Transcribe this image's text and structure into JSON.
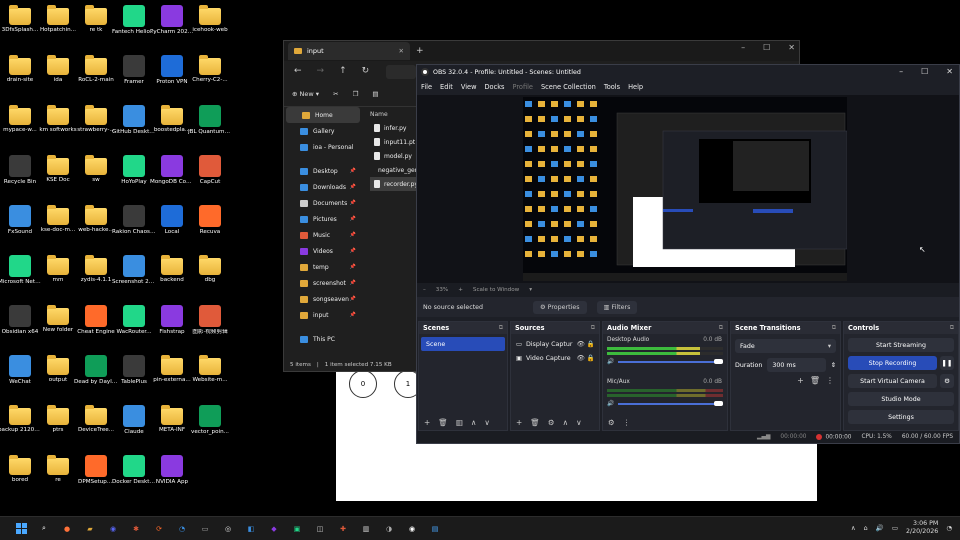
{
  "desktop_icons": [
    {
      "label": "3DfsSplash...",
      "kind": "folder"
    },
    {
      "label": "Hotpatchin...",
      "kind": "folder"
    },
    {
      "label": "re tk",
      "kind": "folder"
    },
    {
      "label": "Fantech Helios XD3",
      "kind": "app"
    },
    {
      "label": "PyCharm 2025.3.2.1",
      "kind": "app"
    },
    {
      "label": "icehook-web",
      "kind": "folder"
    },
    {
      "label": "drain-site",
      "kind": "folder"
    },
    {
      "label": "ida",
      "kind": "folder"
    },
    {
      "label": "RoCL-2-main",
      "kind": "folder"
    },
    {
      "label": "Framer",
      "kind": "app"
    },
    {
      "label": "Proton VPN",
      "kind": "app"
    },
    {
      "label": "Cherry-C2-...",
      "kind": "folder"
    },
    {
      "label": "mypace-w...",
      "kind": "folder"
    },
    {
      "label": "km softworks",
      "kind": "folder"
    },
    {
      "label": "strawberry-...",
      "kind": "folder"
    },
    {
      "label": "GitHub Desktop",
      "kind": "app"
    },
    {
      "label": "boostedpla...",
      "kind": "folder"
    },
    {
      "label": "JBL QuantumE...",
      "kind": "app"
    },
    {
      "label": "Recycle Bin",
      "kind": "app"
    },
    {
      "label": "KSE Doc",
      "kind": "folder"
    },
    {
      "label": "sw",
      "kind": "folder"
    },
    {
      "label": "HoYoPlay",
      "kind": "app"
    },
    {
      "label": "MongoDB Compass",
      "kind": "app"
    },
    {
      "label": "CapCut",
      "kind": "app"
    },
    {
      "label": "FxSound",
      "kind": "app"
    },
    {
      "label": "kse-doc-m...",
      "kind": "folder"
    },
    {
      "label": "web-hacke...",
      "kind": "folder"
    },
    {
      "label": "Rakion Chaos Force",
      "kind": "app"
    },
    {
      "label": "Local",
      "kind": "app"
    },
    {
      "label": "Recuva",
      "kind": "app"
    },
    {
      "label": "Microsoft Network ...",
      "kind": "app"
    },
    {
      "label": "mm",
      "kind": "folder"
    },
    {
      "label": "zydis-4.1.1",
      "kind": "folder"
    },
    {
      "label": "Screenshot 2026-01-...",
      "kind": "app"
    },
    {
      "label": "backend",
      "kind": "folder"
    },
    {
      "label": "dbg",
      "kind": "folder"
    },
    {
      "label": "Obsidian x64",
      "kind": "app"
    },
    {
      "label": "New folder",
      "kind": "folder"
    },
    {
      "label": "Cheat Engine",
      "kind": "app"
    },
    {
      "label": "WacRouter...",
      "kind": "app"
    },
    {
      "label": "Fishstrap",
      "kind": "app"
    },
    {
      "label": "图影·视频剪辑",
      "kind": "app"
    },
    {
      "label": "WeChat",
      "kind": "app"
    },
    {
      "label": "output",
      "kind": "folder"
    },
    {
      "label": "Dead by Daylight",
      "kind": "app"
    },
    {
      "label": "TablePlus",
      "kind": "app"
    },
    {
      "label": "pin-externa...",
      "kind": "folder"
    },
    {
      "label": "Website-m...",
      "kind": "folder"
    },
    {
      "label": "backup 21202...",
      "kind": "folder"
    },
    {
      "label": "ptrs",
      "kind": "folder"
    },
    {
      "label": "DeviceTree...",
      "kind": "folder"
    },
    {
      "label": "Claude",
      "kind": "app"
    },
    {
      "label": "META-INF",
      "kind": "folder"
    },
    {
      "label": "vector_poin...",
      "kind": "app"
    },
    {
      "label": "bored",
      "kind": "folder"
    },
    {
      "label": "re",
      "kind": "folder"
    },
    {
      "label": "DPMSetup....",
      "kind": "app"
    },
    {
      "label": "Docker Desktop",
      "kind": "app"
    },
    {
      "label": "NVIDIA App",
      "kind": "app"
    }
  ],
  "background_window": {
    "nodes": [
      "0",
      "1"
    ]
  },
  "explorer": {
    "tab_title": "input",
    "new_tab": "+",
    "new_button": "New",
    "sidebar": [
      {
        "label": "Home",
        "active": true,
        "color": "#e0a83a"
      },
      {
        "label": "Gallery",
        "active": false,
        "color": "#3a8ee0"
      },
      {
        "label": "ioa - Personal",
        "active": false,
        "color": "#3a8ee0"
      },
      {
        "label": "Desktop",
        "active": false,
        "color": "#3a8ee0"
      },
      {
        "label": "Downloads",
        "active": false,
        "color": "#3a8ee0"
      },
      {
        "label": "Documents",
        "active": false,
        "color": "#cccccc"
      },
      {
        "label": "Pictures",
        "active": false,
        "color": "#3a8ee0"
      },
      {
        "label": "Music",
        "active": false,
        "color": "#e05a3a"
      },
      {
        "label": "Videos",
        "active": false,
        "color": "#8a3ae0"
      },
      {
        "label": "temp",
        "active": false,
        "color": "#e0a83a"
      },
      {
        "label": "screenshot",
        "active": false,
        "color": "#e0a83a"
      },
      {
        "label": "songseaven",
        "active": false,
        "color": "#e0a83a"
      },
      {
        "label": "input",
        "active": false,
        "color": "#e0a83a"
      },
      {
        "label": "This PC",
        "active": false,
        "color": "#3a8ee0"
      }
    ],
    "column_header": "Name",
    "files": [
      {
        "name": "infer.py",
        "selected": false
      },
      {
        "name": "input11.pt",
        "selected": false
      },
      {
        "name": "model.py",
        "selected": false
      },
      {
        "name": "negative_gen...",
        "selected": false
      },
      {
        "name": "recorder.py",
        "selected": true
      }
    ],
    "status_items": "5 items",
    "status_selected": "1 item selected  7.15 KB"
  },
  "obs": {
    "title": "OBS 32.0.4 - Profile: Untitled - Scenes: Untitled",
    "menu": [
      "File",
      "Edit",
      "View",
      "Docks",
      "Profile",
      "Scene Collection",
      "Tools",
      "Help"
    ],
    "zoom": "33%",
    "scale_label": "Scale to Window",
    "no_source": "No source selected",
    "properties_btn": "Properties",
    "filters_btn": "Filters",
    "scenes": {
      "title": "Scenes",
      "items": [
        "Scene"
      ]
    },
    "sources": {
      "title": "Sources",
      "items": [
        "Display Captur",
        "Video Capture"
      ]
    },
    "mixer": {
      "title": "Audio Mixer",
      "channels": [
        {
          "name": "Desktop Audio",
          "db": "0.0 dB"
        },
        {
          "name": "Mic/Aux",
          "db": "0.0 dB"
        }
      ]
    },
    "transitions": {
      "title": "Scene Transitions",
      "type": "Fade",
      "duration_label": "Duration",
      "duration": "300 ms"
    },
    "controls": {
      "title": "Controls",
      "start_streaming": "Start Streaming",
      "stop_recording": "Stop Recording",
      "start_virtual_camera": "Start Virtual Camera",
      "studio_mode": "Studio Mode",
      "settings": "Settings"
    },
    "status": {
      "stream_time": "00:00:00",
      "rec_time": "00:00:00",
      "cpu": "CPU: 1.5%",
      "fps": "60.00 / 60.00 FPS"
    }
  },
  "taskbar": {
    "time": "3:06 PM",
    "date": "2/20/2026"
  }
}
